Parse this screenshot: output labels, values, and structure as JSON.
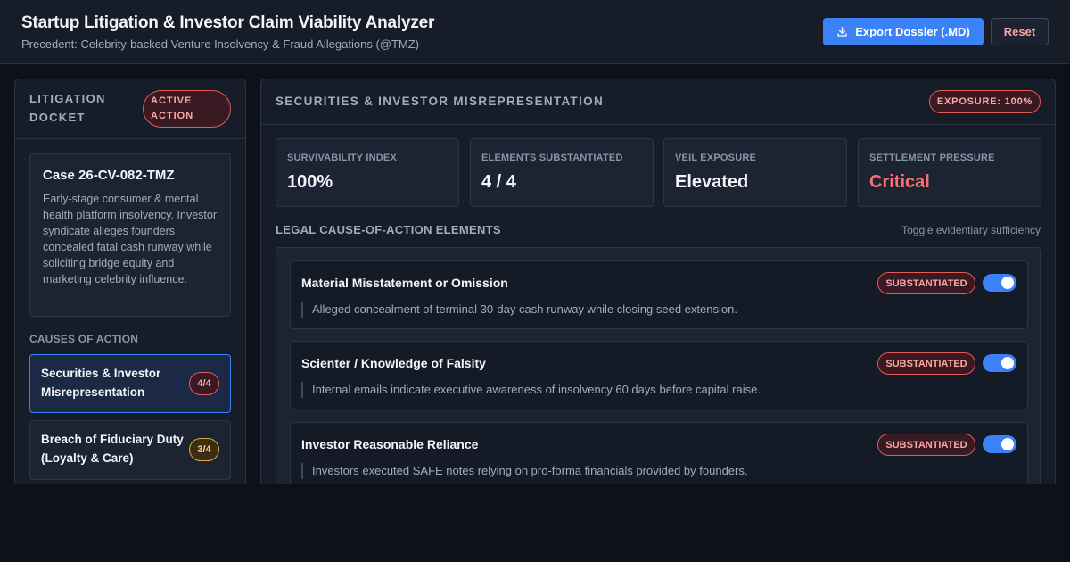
{
  "header": {
    "title": "Startup Litigation & Investor Claim Viability Analyzer",
    "subtitle": "Precedent: Celebrity-backed Venture Insolvency & Fraud Allegations (@TMZ)",
    "export_label": "Export Dossier (.MD)",
    "reset_label": "Reset"
  },
  "docket": {
    "title": "LITIGATION DOCKET",
    "badge": "ACTIVE ACTION",
    "case_title": "Case 26-CV-082-TMZ",
    "case_desc": "Early-stage consumer & mental health platform insolvency. Investor syndicate alleges founders concealed fatal cash runway while soliciting bridge equity and marketing celebrity influence.",
    "causes_label": "CAUSES OF ACTION",
    "causes": [
      {
        "label": "Securities & Investor Misrepresentation",
        "count": "4/4",
        "status": "red"
      },
      {
        "label": "Breach of Fiduciary Duty (Loyalty & Care)",
        "count": "3/4",
        "status": "amber"
      }
    ]
  },
  "main": {
    "section_title": "SECURITIES & INVESTOR MISREPRESENTATION",
    "exposure_badge": "EXPOSURE: 100%",
    "metrics": [
      {
        "label": "SURVIVABILITY INDEX",
        "value": "100%"
      },
      {
        "label": "ELEMENTS SUBSTANTIATED",
        "value": "4 / 4"
      },
      {
        "label": "VEIL EXPOSURE",
        "value": "Elevated"
      },
      {
        "label": "SETTLEMENT PRESSURE",
        "value": "Critical"
      }
    ],
    "elements_title": "LEGAL CAUSE-OF-ACTION ELEMENTS",
    "elements_hint": "Toggle evidentiary sufficiency",
    "elements": [
      {
        "title": "Material Misstatement or Omission",
        "status": "SUBSTANTIATED",
        "enabled": true,
        "desc": "Alleged concealment of terminal 30-day cash runway while closing seed extension."
      },
      {
        "title": "Scienter / Knowledge of Falsity",
        "status": "SUBSTANTIATED",
        "enabled": true,
        "desc": "Internal emails indicate executive awareness of insolvency 60 days before capital raise."
      },
      {
        "title": "Investor Reasonable Reliance",
        "status": "SUBSTANTIATED",
        "enabled": true,
        "desc": "Investors executed SAFE notes relying on pro-forma financials provided by founders."
      }
    ]
  },
  "colors": {
    "accent": "#3b82f6",
    "danger": "#f87171",
    "warning": "#e0a83a",
    "background": "#0c111a"
  }
}
